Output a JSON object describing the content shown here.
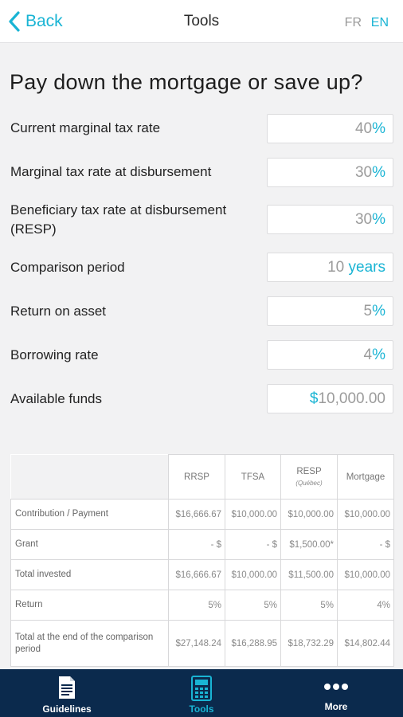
{
  "header": {
    "back_label": "Back",
    "title": "Tools",
    "lang_fr": "FR",
    "lang_en": "EN"
  },
  "page_title": "Pay down the mortgage or save up?",
  "fields": [
    {
      "label": "Current marginal tax rate",
      "value": "40",
      "unit": "%"
    },
    {
      "label": "Marginal tax rate at disbursement",
      "value": "30",
      "unit": "%"
    },
    {
      "label_line1": "Beneficiary tax rate at disbursement",
      "label_line2": "(RESP)",
      "value": "30",
      "unit": "%"
    },
    {
      "label": "Comparison period",
      "value": "10",
      "unit": " years"
    },
    {
      "label": "Return on asset",
      "value": "5",
      "unit": "%"
    },
    {
      "label": "Borrowing rate",
      "value": "4",
      "unit": "%"
    },
    {
      "label": "Available funds",
      "prefix": "$",
      "value": "10,000.00"
    }
  ],
  "table": {
    "headers": [
      "RRSP",
      "TFSA",
      "RESP",
      "Mortgage"
    ],
    "resp_sub": "(Québec)",
    "rows": [
      {
        "label": "Contribution / Payment",
        "cells": [
          "$16,666.67",
          "$10,000.00",
          "$10,000.00",
          "$10,000.00"
        ]
      },
      {
        "label": "Grant",
        "cells": [
          "- $",
          "- $",
          "$1,500.00*",
          "- $"
        ]
      },
      {
        "label": "Total invested",
        "cells": [
          "$16,666.67",
          "$10,000.00",
          "$11,500.00",
          "$10,000.00"
        ]
      },
      {
        "label": "Return",
        "cells": [
          "5%",
          "5%",
          "5%",
          "4%"
        ]
      },
      {
        "label": "Total at the end of the comparison period",
        "cells": [
          "$27,148.24",
          "$16,288.95",
          "$18,732.29",
          "$14,802.44"
        ]
      }
    ]
  },
  "tabs": [
    {
      "label": "Guidelines",
      "icon": "document-icon"
    },
    {
      "label": "Tools",
      "icon": "calculator-icon"
    },
    {
      "label": "More",
      "icon": "more-dots-icon"
    }
  ],
  "colors": {
    "accent": "#19b4d4",
    "nav_bg": "#0b2a4d",
    "page_bg": "#f2f2f3"
  }
}
